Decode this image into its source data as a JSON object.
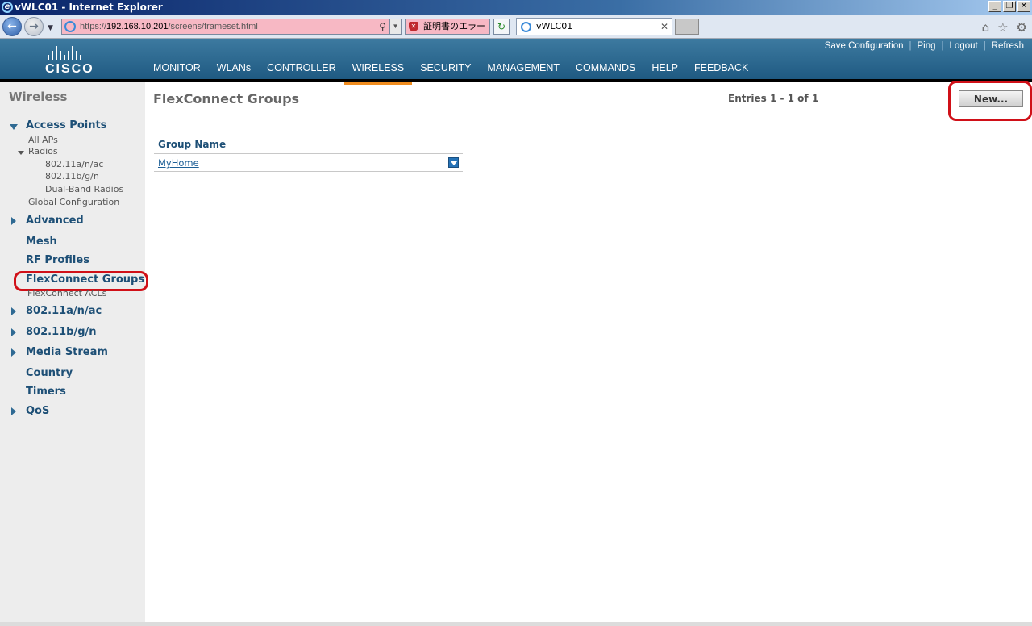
{
  "window": {
    "title": "vWLC01 - Internet Explorer"
  },
  "browser": {
    "url_prefix": "https://",
    "url_host": "192.168.10.201",
    "url_path": "/screens/frameset.html",
    "cert_error": "証明書のエラー",
    "tab_title": "vWLC01"
  },
  "header": {
    "logo_text": "CISCO",
    "menu": [
      "MONITOR",
      "WLANs",
      "CONTROLLER",
      "WIRELESS",
      "SECURITY",
      "MANAGEMENT",
      "COMMANDS",
      "HELP",
      "FEEDBACK"
    ],
    "active_menu": "WIRELESS",
    "util": [
      "Save Configuration",
      "Ping",
      "Logout",
      "Refresh"
    ]
  },
  "sidebar": {
    "title": "Wireless",
    "access_points": "Access Points",
    "all_aps": "All APs",
    "radios": "Radios",
    "radio_a": "802.11a/n/ac",
    "radio_b": "802.11b/g/n",
    "dual_band": "Dual-Band Radios",
    "global_config": "Global Configuration",
    "advanced": "Advanced",
    "mesh": "Mesh",
    "rf_profiles": "RF Profiles",
    "flex_groups": "FlexConnect Groups",
    "flex_acls": "FlexConnect ACLs",
    "nav_a": "802.11a/n/ac",
    "nav_b": "802.11b/g/n",
    "media_stream": "Media Stream",
    "country": "Country",
    "timers": "Timers",
    "qos": "QoS"
  },
  "main": {
    "title": "FlexConnect Groups",
    "entries": "Entries 1 - 1 of 1",
    "new_button": "New...",
    "table": {
      "header": "Group Name",
      "rows": [
        "MyHome"
      ]
    }
  }
}
